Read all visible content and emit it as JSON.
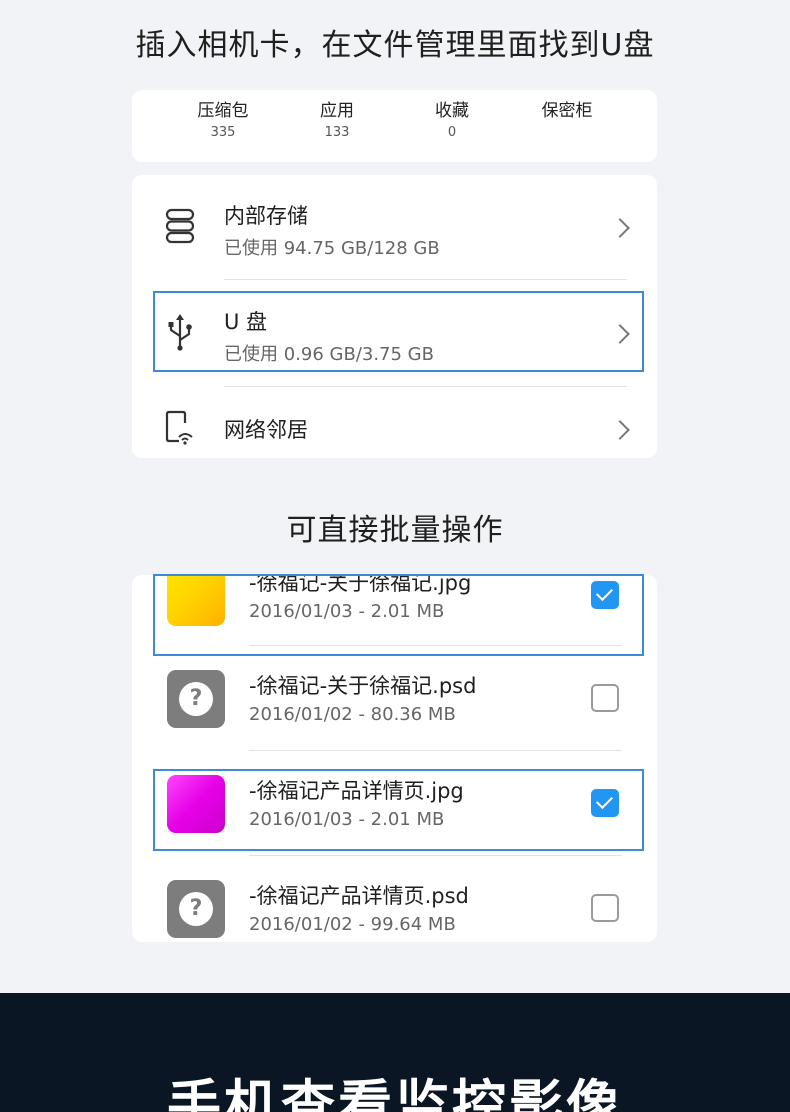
{
  "header": {
    "title": "插入相机卡，在文件管理里面找到U盘"
  },
  "categories": [
    {
      "name": "压缩包",
      "count": "335"
    },
    {
      "name": "应用",
      "count": "133"
    },
    {
      "name": "收藏",
      "count": "0"
    },
    {
      "name": "保密柜",
      "count": ""
    }
  ],
  "storage": {
    "internal": {
      "title": "内部存储",
      "usage": "已使用 94.75 GB/128 GB"
    },
    "usb": {
      "title": "U 盘",
      "usage": "已使用 0.96 GB/3.75 GB"
    },
    "network": {
      "title": "网络邻居"
    }
  },
  "section2": {
    "title": "可直接批量操作"
  },
  "files": [
    {
      "name": "-徐福记-关于徐福记.jpg",
      "meta": "2016/01/03 - 2.01 MB",
      "checked": true,
      "thumb": "yellow-image"
    },
    {
      "name": "-徐福记-关于徐福记.psd",
      "meta": "2016/01/02 - 80.36 MB",
      "checked": false,
      "thumb": "unknown-file-icon"
    },
    {
      "name": "-徐福记产品详情页.jpg",
      "meta": "2016/01/03 - 2.01 MB",
      "checked": true,
      "thumb": "magenta-image"
    },
    {
      "name": "-徐福记产品详情页.psd",
      "meta": "2016/01/02 - 99.64 MB",
      "checked": false,
      "thumb": "unknown-file-icon"
    }
  ],
  "banner": {
    "text": "手机查看监控影像"
  },
  "colors": {
    "accent": "#2196f3",
    "highlight": "#3e8ad9",
    "banner_bg": "#0a1624"
  }
}
